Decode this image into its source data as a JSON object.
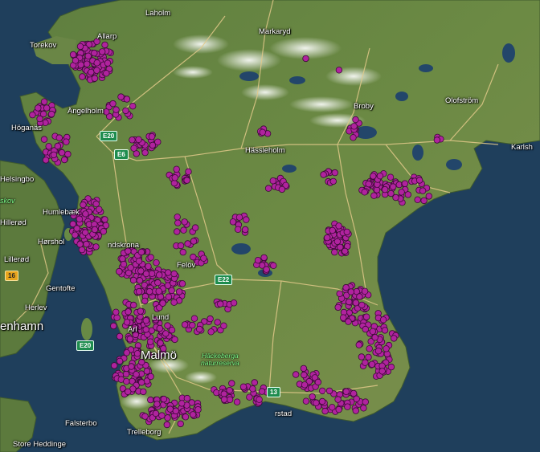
{
  "map": {
    "places": {
      "laholm": "Laholm",
      "markaryd": "Markaryd",
      "torekov": "Torekov",
      "allarp": "Allarp",
      "angelholm": "Ängelholm",
      "hoganas": "Höganäs",
      "broby": "Broby",
      "olofstrom": "Olofström",
      "karlshamn": "Karlsh",
      "hassleholm": "Hässleholm",
      "helsingborg": "Helsingbo",
      "humlebaek": "Humlebæk",
      "hillerod": "Hillerød",
      "horsholm": "Hørshol",
      "lillerod": "Lillerød",
      "gentofte": "Gentofte",
      "herlev": "Herlev",
      "kobenhavn": "enhamn",
      "lund": "Lund",
      "arlov": "Arl",
      "falsterbo": "Falsterbo",
      "trelleborg": "Trelleborg",
      "store_heddinge": "Store Heddinge",
      "ystad": "rstad",
      "felov": "Felöv",
      "landskrona": "ndskrona",
      "malmo": "Malmö",
      "skov": "skov"
    },
    "nature_reserve": [
      "Häckeberga",
      "naturreserva"
    ],
    "road_shields": {
      "e20_north": "E20",
      "e20_south": "E20",
      "e22": "E22",
      "e6": "E6",
      "route16": "16",
      "ystad_shield": "13"
    },
    "marker_color": "#b0239e",
    "marker_stroke": "#3a0a35",
    "land_color": "#5a7a3c",
    "water_color": "#1f3f5c"
  }
}
